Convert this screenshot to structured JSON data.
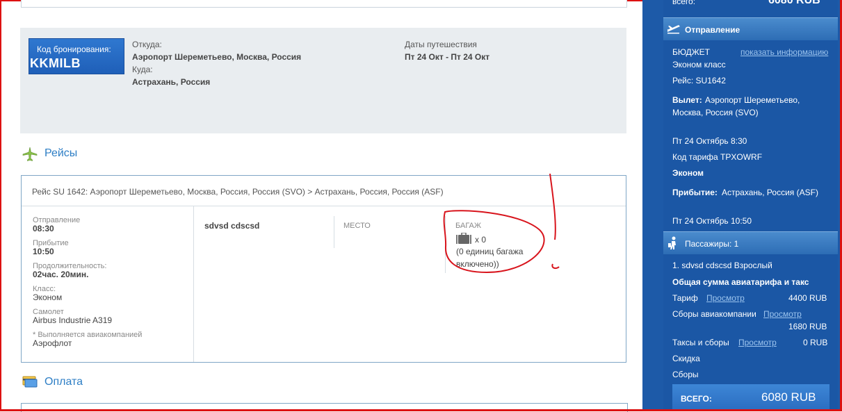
{
  "booking": {
    "code_label": "Код бронирования:",
    "code_value": "KKMILB",
    "from_label": "Откуда:",
    "from_value": "Аэропорт Шереметьево, Москва, Россия",
    "to_label": "Куда:",
    "to_value": "Астрахань, Россия",
    "dates_label": "Даты путешествия",
    "dates_value": "Пт 24 Окт - Пт 24 Окт"
  },
  "sections": {
    "flights_title": "Рейсы",
    "payment_title": "Оплата"
  },
  "flight": {
    "header": "Рейс SU 1642: Аэропорт Шереметьево, Москва, Россия, Россия (SVO) > Астрахань, Россия, Россия (ASF)",
    "departure_label": "Отправление",
    "departure_value": "08:30",
    "arrival_label": "Прибытие",
    "arrival_value": "10:50",
    "duration_label": "Продолжительность:",
    "duration_value": "02час. 20мин.",
    "class_label": "Класс:",
    "class_value": "Эконом",
    "plane_label": "Самолет",
    "plane_value": "Airbus Industrie A319",
    "operated_label": "* Выполняется авиакомпанией",
    "operated_value": "Аэрофлот",
    "passenger_name": "sdvsd cdscsd",
    "seat_label": "МЕСТО",
    "baggage_label": "БАГАЖ",
    "baggage_count": "x 0",
    "baggage_note_line1": "(0 единиц багажа",
    "baggage_note_line2": "включено))"
  },
  "sidebar": {
    "top_label": "всего:",
    "top_amount": "6080 RUB",
    "departure_header": "Отправление",
    "fare_family": "БЮДЖЕТ",
    "show_info_link": "показать информацию",
    "cabin": "Эконом класс",
    "flight_no": "Рейс: SU1642",
    "dep_label": "Вылет:",
    "dep_line1": "Аэропорт Шереметьево,",
    "dep_line2": "Москва, Россия (SVO)",
    "dep_time": "Пт 24 Октябрь 8:30",
    "fare_code": "Код тарифа TPXOWRF",
    "fare_class": "Эконом",
    "arr_label": "Прибытие:",
    "arr_place": "Астрахань, Россия (ASF)",
    "arr_time": "Пт 24 Октябрь 10:50",
    "passengers_header": "Пассажиры: 1",
    "passenger_line": "1. sdvsd cdscsd Взрослый",
    "total_heading": "Общая сумма авиатарифа и такс",
    "tariff_label": "Тариф",
    "view_link": "Просмотр",
    "tariff_amount": "4400 RUB",
    "airline_fees_label": "Сборы авиакомпании",
    "airline_fees_amount": "1680 RUB",
    "taxes_label": "Таксы и сборы",
    "taxes_amount": "0 RUB",
    "discount_label": "Скидка",
    "fees_label": "Сборы",
    "total_label": "ВСЕГО:",
    "total_amount": "6080 RUB"
  }
}
